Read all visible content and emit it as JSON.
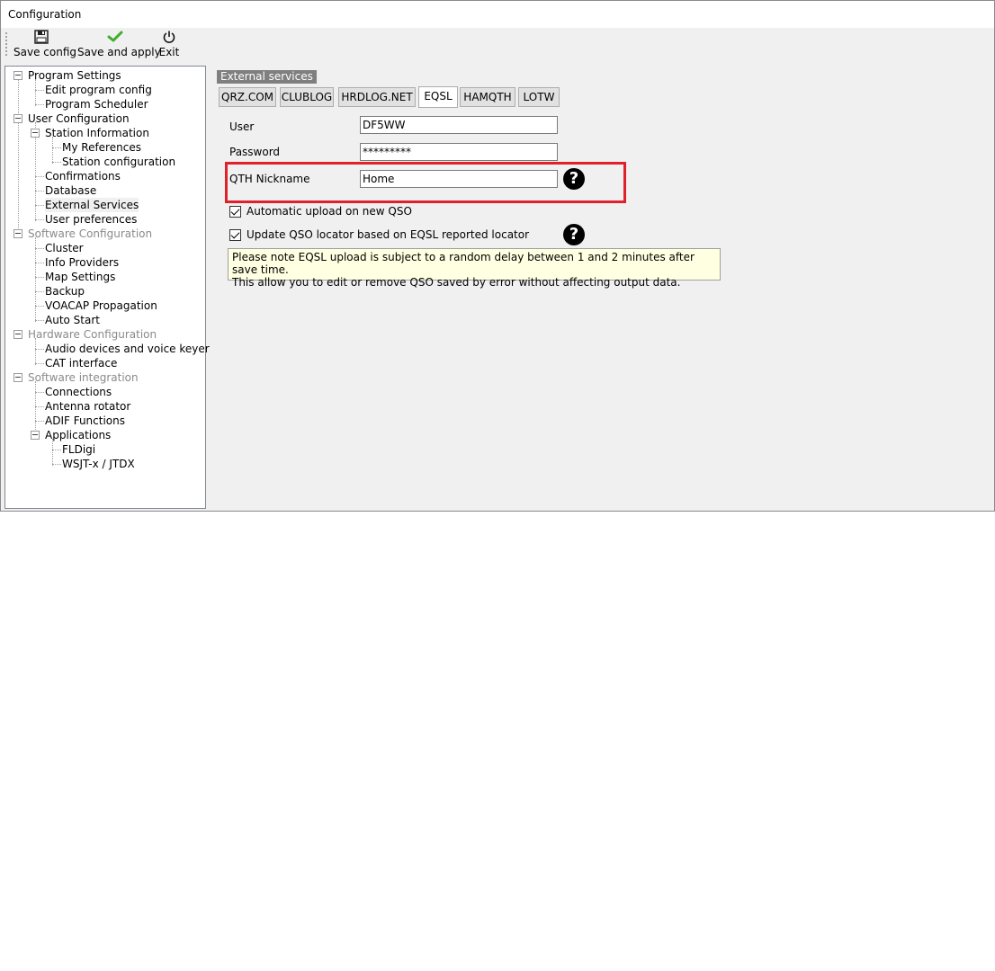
{
  "window": {
    "title": "Configuration"
  },
  "toolbar": {
    "save_config": "Save config",
    "save_and_apply": "Save and apply",
    "exit": "Exit"
  },
  "tree": {
    "program_settings": "Program Settings",
    "edit_program_config": "Edit program config",
    "program_scheduler": "Program Scheduler",
    "user_configuration": "User Configuration",
    "station_information": "Station Information",
    "my_references": "My References",
    "station_configuration": "Station configuration",
    "confirmations": "Confirmations",
    "database": "Database",
    "external_services": "External Services",
    "user_preferences": "User preferences",
    "software_configuration": "Software Configuration",
    "cluster": "Cluster",
    "info_providers": "Info Providers",
    "map_settings": "Map Settings",
    "backup": "Backup",
    "voacap": "VOACAP Propagation",
    "auto_start": "Auto Start",
    "hardware_configuration": "Hardware Configuration",
    "audio_devices": "Audio devices and voice keyer",
    "cat_interface": "CAT interface",
    "software_integration": "Software integration",
    "connections": "Connections",
    "antenna_rotator": "Antenna rotator",
    "adif_functions": "ADIF Functions",
    "applications": "Applications",
    "fldigi": "FLDigi",
    "wsjtx": "WSJT-x / JTDX"
  },
  "panel": {
    "group_caption": "External services",
    "tabs": [
      "QRZ.COM",
      "CLUBLOG",
      "HRDLOG.NET",
      "EQSL",
      "HAMQTH",
      "LOTW"
    ],
    "active_tab": "EQSL",
    "user_label": "User",
    "user_value": "DF5WW",
    "password_label": "Password",
    "password_value": "*********",
    "qth_label": "QTH Nickname",
    "qth_value": "Home",
    "auto_upload_label": "Automatic upload on new QSO",
    "auto_upload_checked": true,
    "update_locator_label": "Update QSO locator based on EQSL reported locator",
    "update_locator_checked": true,
    "note_line1": "Please note EQSL upload is subject to a random delay between 1 and 2 minutes after save time.",
    "note_line2": "This allow you to edit or remove QSO saved by error without affecting output data.",
    "help_glyph": "?"
  },
  "colors": {
    "highlight": "#e0202a",
    "note_bg": "#ffffe1"
  }
}
